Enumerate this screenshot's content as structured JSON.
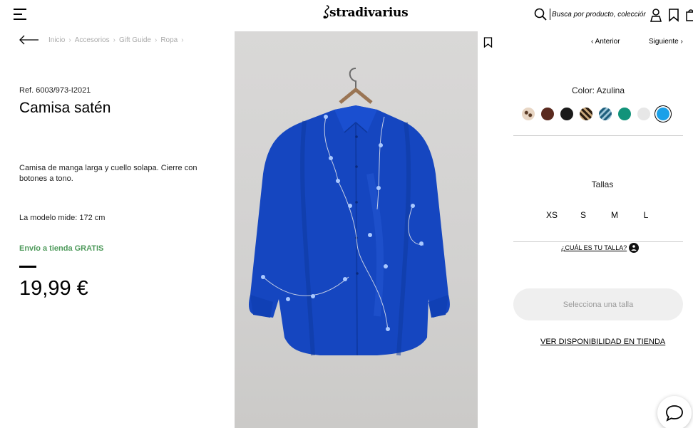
{
  "header": {
    "logo": "stradivarius",
    "search_placeholder": "Busca por producto, colección..."
  },
  "breadcrumb": [
    "Inicio",
    "Accesorios",
    "Gift Guide",
    "Ropa"
  ],
  "product": {
    "ref": "Ref. 6003/973-I2021",
    "title": "Camisa satén",
    "description": "Camisa de manga larga y cuello solapa. Cierre con botones a tono.",
    "model_info": "La modelo mide: 172 cm",
    "shipping": "Envío a tienda GRATIS",
    "price": "19,99 €"
  },
  "navigation": {
    "prev": "Anterior",
    "next": "Siguiente"
  },
  "color": {
    "label": "Color: Azulina",
    "swatches": [
      {
        "name": "animal-print-beige",
        "color": "#e8d6c4"
      },
      {
        "name": "brown",
        "color": "#5a2a1f"
      },
      {
        "name": "black",
        "color": "#1a1a1a"
      },
      {
        "name": "zebra-print",
        "color": "#8a6a45"
      },
      {
        "name": "blue-print",
        "color": "#4f8aa6"
      },
      {
        "name": "green",
        "color": "#12937a"
      },
      {
        "name": "white",
        "color": "#e7e7e7"
      },
      {
        "name": "azulina",
        "color": "#1aa0e8"
      }
    ]
  },
  "sizes": {
    "label": "Tallas",
    "options": [
      "XS",
      "S",
      "M",
      "L"
    ],
    "guide": "¿CUÁL ES TU TALLA?"
  },
  "actions": {
    "select_size": "Selecciona una talla",
    "store_availability": "VER DISPONIBILIDAD EN TIENDA"
  },
  "colors": {
    "shipping_green": "#4e9a5b",
    "shirt_blue": "#1546c0"
  }
}
